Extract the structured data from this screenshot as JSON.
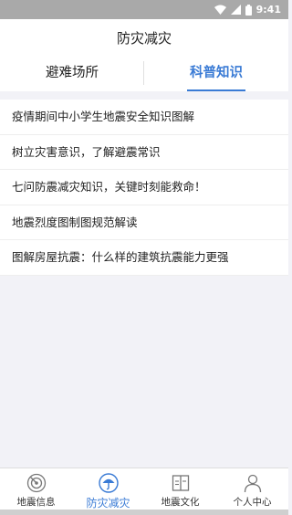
{
  "status_bar": {
    "time": "9:41",
    "icons": [
      "wifi-icon",
      "signal-icon",
      "battery-icon"
    ]
  },
  "header": {
    "title": "防灾减灾"
  },
  "tabs": [
    {
      "label": "避难场所",
      "active": false
    },
    {
      "label": "科普知识",
      "active": true
    }
  ],
  "articles": [
    {
      "title": "疫情期间中小学生地震安全知识图解"
    },
    {
      "title": "树立灾害意识，了解避震常识"
    },
    {
      "title": "七问防震减灾知识，关键时刻能救命！"
    },
    {
      "title": "地震烈度图制图规范解读"
    },
    {
      "title": "图解房屋抗震：什么样的建筑抗震能力更强"
    }
  ],
  "bottom_nav": [
    {
      "label": "地震信息",
      "icon": "radar-icon",
      "active": false
    },
    {
      "label": "防灾减灾",
      "icon": "umbrella-icon",
      "active": true
    },
    {
      "label": "地震文化",
      "icon": "book-icon",
      "active": false
    },
    {
      "label": "个人中心",
      "icon": "person-icon",
      "active": false
    }
  ],
  "colors": {
    "accent": "#3a7bd5",
    "status_bar": "#a9a9a9",
    "background": "#f2f2f7",
    "text": "#222222"
  }
}
